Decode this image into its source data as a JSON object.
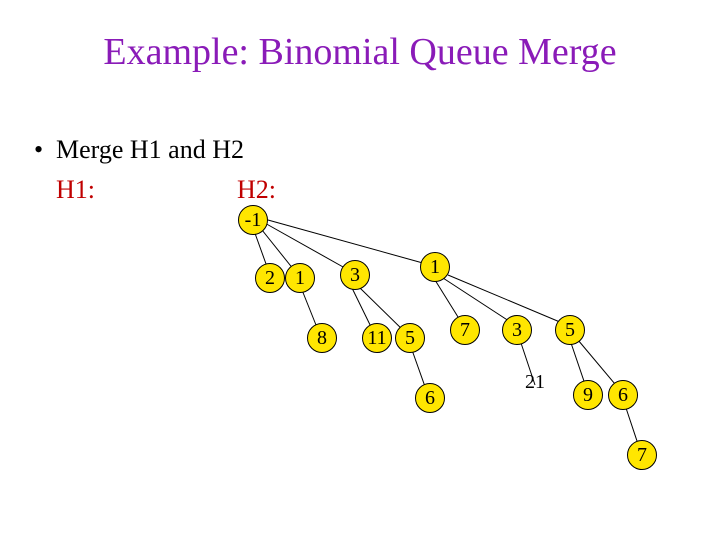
{
  "title": "Example: Binomial Queue Merge",
  "bullet": "Merge H1 and H2",
  "labels": {
    "h1": "H1:",
    "h2": "H2:"
  },
  "nodes": {
    "root": "-1",
    "c2": "2",
    "c1a": "1",
    "c3": "3",
    "c1b": "1",
    "n8": "8",
    "n11": "11",
    "n5a": "5",
    "n7a": "7",
    "n3b": "3",
    "n5b": "5",
    "n6a": "6",
    "n21": "21",
    "n9": "9",
    "n6b": "6",
    "n7b": "7"
  }
}
